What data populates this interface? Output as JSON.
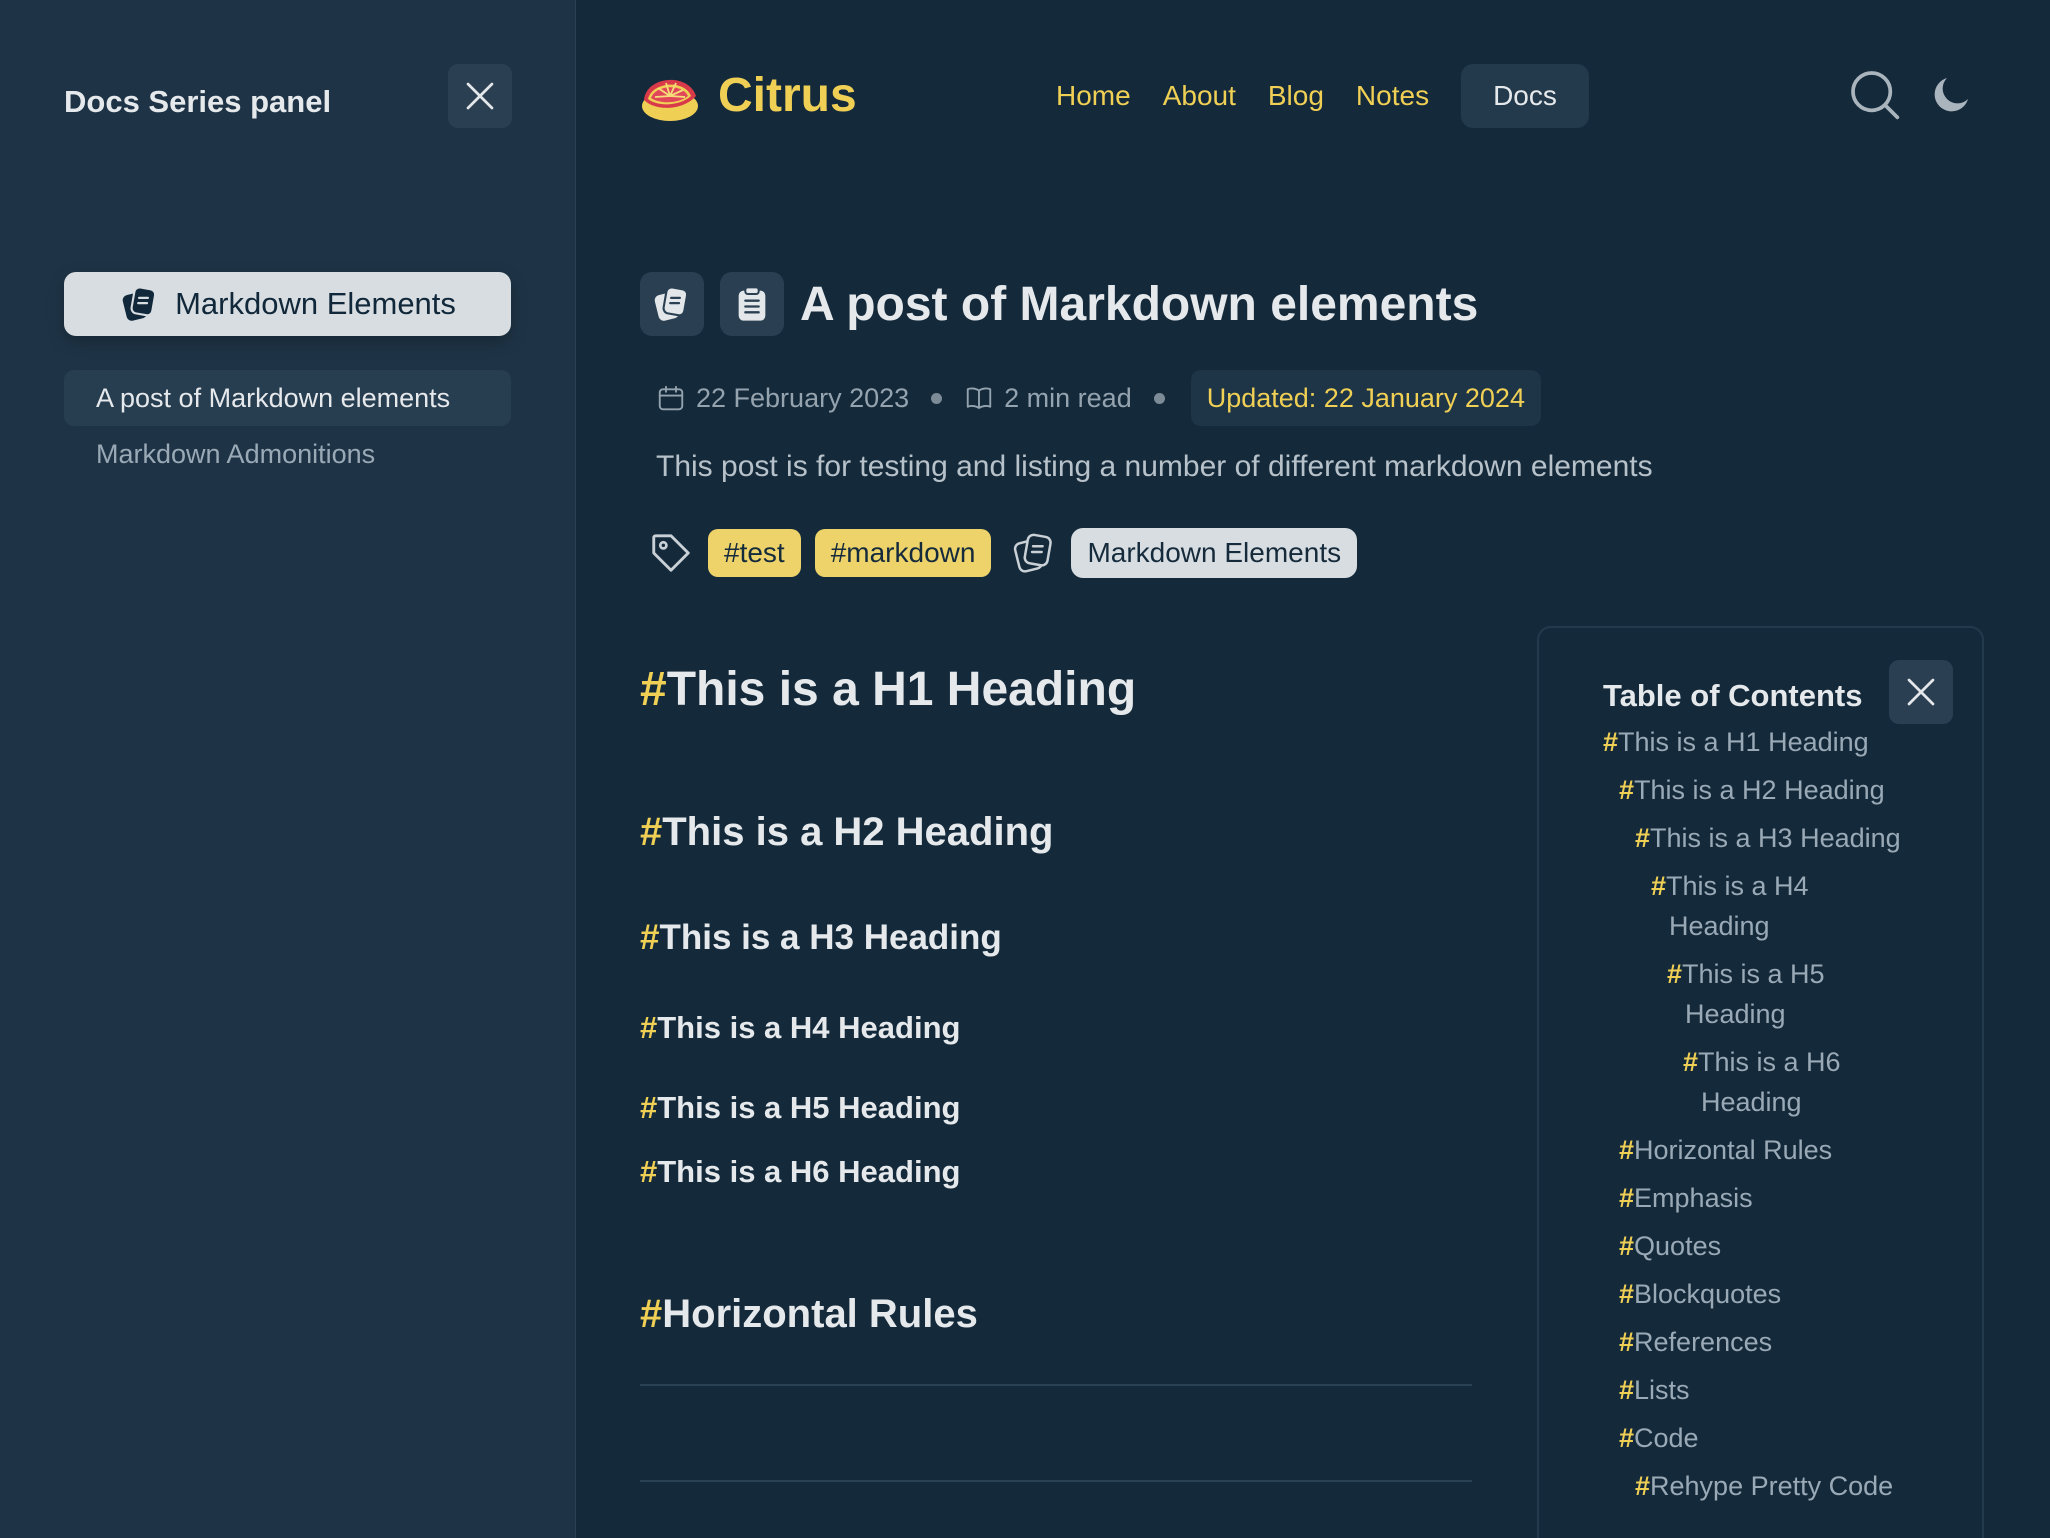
{
  "series_panel": {
    "title": "Docs Series panel",
    "series_name": "Markdown Elements",
    "items": [
      {
        "label": "A post of Markdown elements",
        "active": true
      },
      {
        "label": "Markdown Admonitions",
        "active": false
      }
    ]
  },
  "header": {
    "logo_text": "Citrus",
    "nav": [
      "Home",
      "About",
      "Blog",
      "Notes",
      "Docs"
    ],
    "current_nav": "Docs"
  },
  "post": {
    "title": "A post of Markdown elements",
    "date": "22 February 2023",
    "read_time": "2 min read",
    "updated": "Updated: 22 January 2024",
    "description": "This post is for testing and listing a number of different markdown elements",
    "tags": [
      "#test",
      "#markdown"
    ],
    "series": "Markdown Elements"
  },
  "content": {
    "hash": "#",
    "headings": [
      "This is a H1 Heading",
      "This is a H2 Heading",
      "This is a H3 Heading",
      "This is a H4 Heading",
      "This is a H5 Heading",
      "This is a H6 Heading",
      "Horizontal Rules"
    ]
  },
  "toc": {
    "title": "Table of Contents",
    "items": [
      {
        "line1": "This is a H1 Heading",
        "line2": ""
      },
      {
        "line1": "This is a H2 Heading",
        "line2": ""
      },
      {
        "line1": "This is a H3 Heading",
        "line2": ""
      },
      {
        "line1": "This is a H4",
        "line2": "Heading"
      },
      {
        "line1": "This is a H5",
        "line2": "Heading"
      },
      {
        "line1": "This is a H6",
        "line2": "Heading"
      },
      {
        "line1": "Horizontal Rules",
        "line2": ""
      },
      {
        "line1": "Emphasis",
        "line2": ""
      },
      {
        "line1": "Quotes",
        "line2": ""
      },
      {
        "line1": "Blockquotes",
        "line2": ""
      },
      {
        "line1": "References",
        "line2": ""
      },
      {
        "line1": "Lists",
        "line2": ""
      },
      {
        "line1": "Code",
        "line2": ""
      },
      {
        "line1": "Rehype Pretty Code",
        "line2": ""
      }
    ]
  },
  "colors": {
    "accent": "#f0cf55",
    "background": "#142a3b",
    "panel": "#1e3446"
  },
  "icons": {
    "close": "close-icon",
    "series": "series-icon",
    "document": "document-icon",
    "calendar": "calendar-icon",
    "book": "book-icon",
    "tag": "tag-icon",
    "search": "search-icon",
    "moon": "moon-icon",
    "logo": "citrus-logo-icon"
  }
}
